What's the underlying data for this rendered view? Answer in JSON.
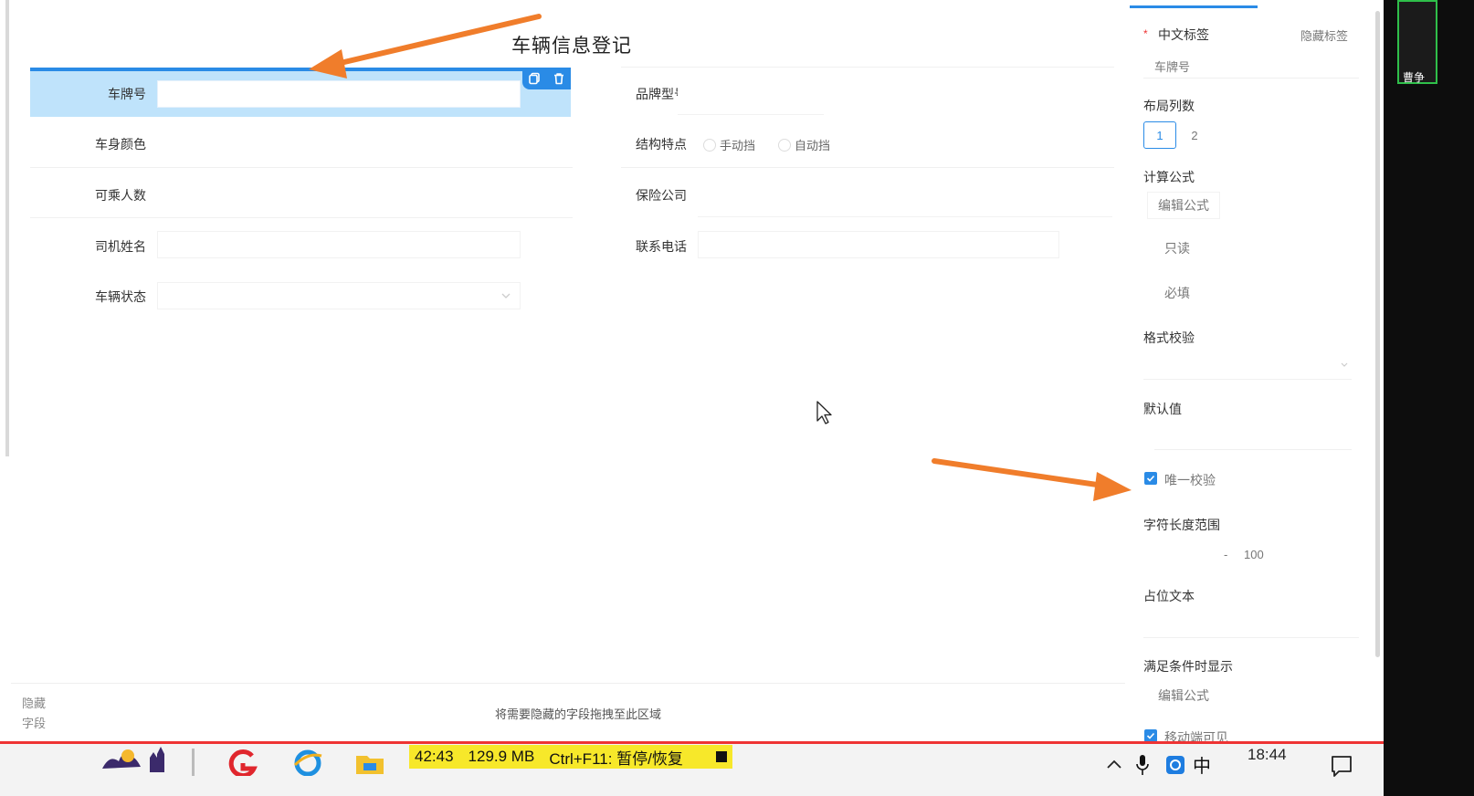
{
  "form": {
    "title": "车辆信息登记",
    "fields": {
      "plate_label": "车牌号",
      "brand_label": "品牌型号",
      "color_label": "车身颜色",
      "structure_label": "结构特点",
      "structure_options": [
        "手动挡",
        "自动挡"
      ],
      "passengers_label": "可乘人数",
      "insurer_label": "保险公司",
      "driver_label": "司机姓名",
      "phone_label": "联系电话",
      "status_label": "车辆状态"
    },
    "hidden_zone": {
      "label_line1": "隐藏",
      "label_line2": "字段",
      "hint": "将需要隐藏的字段拖拽至此区域"
    }
  },
  "panel": {
    "cn_label_title": "中文标签",
    "required_star": "*",
    "hide_label_link": "隐藏标签",
    "cn_label_value": "车牌号",
    "layout_cols_title": "布局列数",
    "layout_cols_options": [
      "1",
      "2"
    ],
    "layout_cols_selected": "1",
    "formula_title": "计算公式",
    "formula_button": "编辑公式",
    "readonly_label": "只读",
    "required_label": "必填",
    "format_check_title": "格式校验",
    "default_value_title": "默认值",
    "unique_check_label": "唯一校验",
    "unique_check_checked": true,
    "length_range_title": "字符长度范围",
    "length_range_sep": "-",
    "length_range_max": "100",
    "placeholder_title": "占位文本",
    "conditional_title": "满足条件时显示",
    "conditional_button": "编辑公式",
    "mobile_visible_label": "移动端可见",
    "mobile_visible_checked": true
  },
  "side_user": {
    "name": "曹争"
  },
  "recorder": {
    "elapsed": "42:43",
    "size": "129.9 MB",
    "shortcut": "Ctrl+F11: 暂停/恢复"
  },
  "taskbar": {
    "ime": "中",
    "time": "18:44"
  },
  "colors": {
    "accent": "#2a8be6",
    "selected_row_bg": "#bfe3fb",
    "arrow": "#f07d2b",
    "recorder_bg": "#f7e82a",
    "taskbar_redline": "#e33333"
  }
}
